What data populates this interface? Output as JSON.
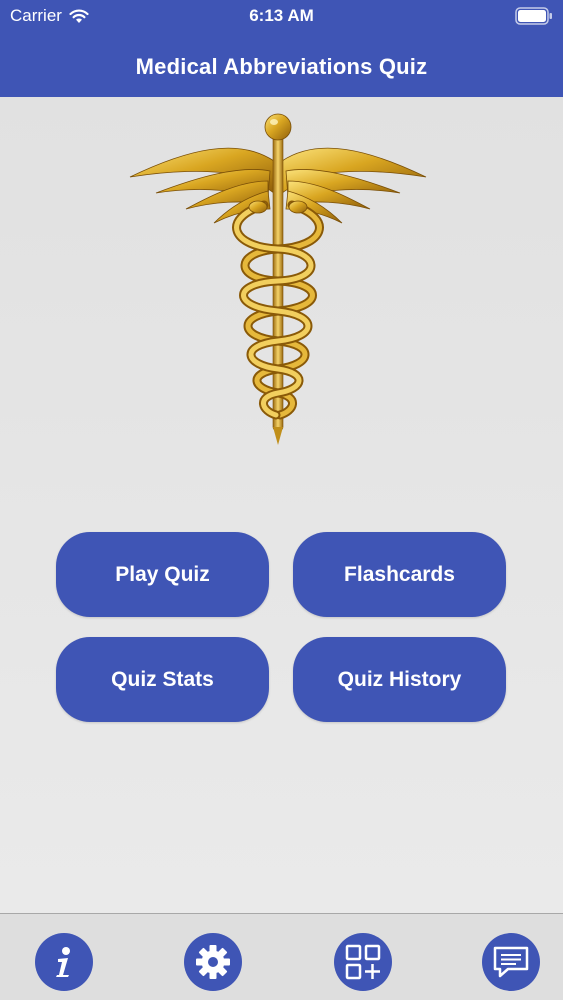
{
  "status_bar": {
    "carrier": "Carrier",
    "time": "6:13 AM",
    "wifi_icon": "wifi-icon",
    "battery_icon": "battery-icon"
  },
  "header": {
    "title": "Medical Abbreviations Quiz"
  },
  "hero": {
    "icon": "caduceus-icon"
  },
  "menu": {
    "play_quiz": "Play Quiz",
    "flashcards": "Flashcards",
    "quiz_stats": "Quiz Stats",
    "quiz_history": "Quiz History"
  },
  "tab_bar": {
    "items": [
      {
        "icon": "info-icon"
      },
      {
        "icon": "gear-icon"
      },
      {
        "icon": "apps-grid-plus-icon"
      },
      {
        "icon": "chat-message-icon"
      }
    ]
  },
  "colors": {
    "accent": "#3f55b5",
    "background": "#e9e9e9",
    "gold": "#d4a21e"
  }
}
